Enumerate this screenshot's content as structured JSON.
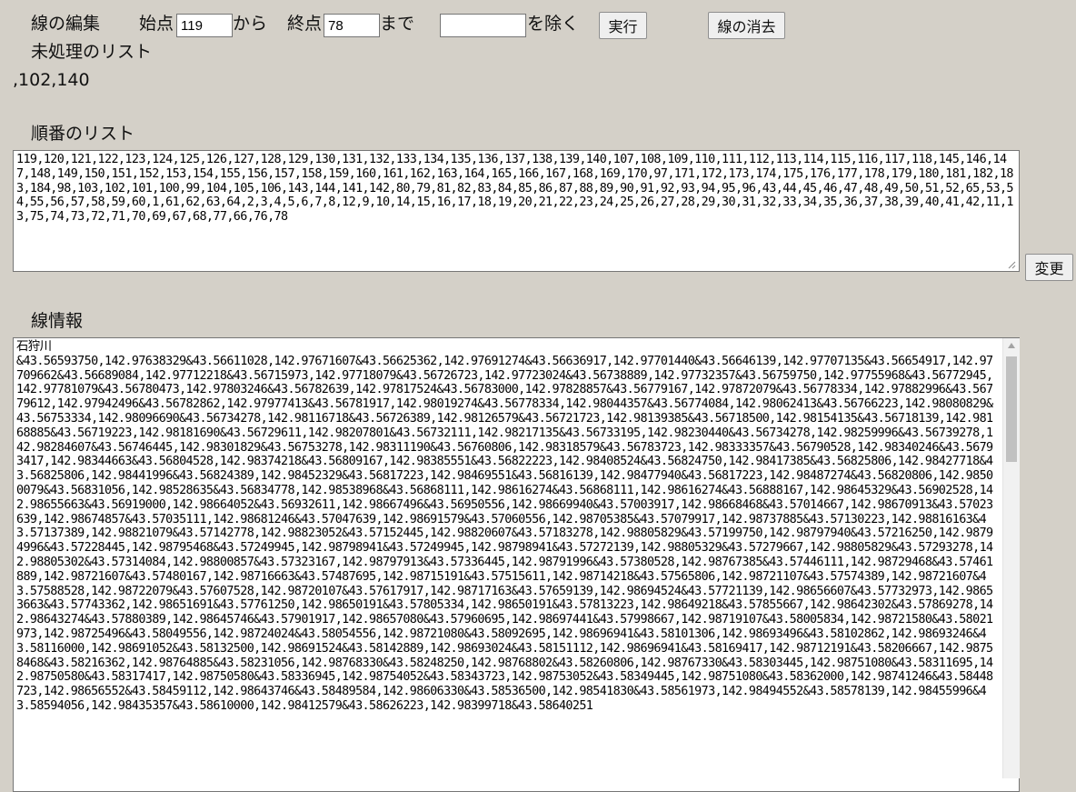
{
  "toolbar": {
    "title": "線の編集",
    "start_label": "始点",
    "start_value": "119",
    "from_label": "から",
    "end_label": "終点",
    "end_value": "78",
    "until_label": "まで",
    "exclude_value": "",
    "exclude_label": "を除く",
    "run_button": "実行",
    "clear_button": "線の消去"
  },
  "unprocessed": {
    "heading": "未処理のリスト",
    "value": ",102,140"
  },
  "order": {
    "heading": "順番のリスト",
    "value": "119,120,121,122,123,124,125,126,127,128,129,130,131,132,133,134,135,136,137,138,139,140,107,108,109,110,111,112,113,114,115,116,117,118,145,146,147,148,149,150,151,152,153,154,155,156,157,158,159,160,161,162,163,164,165,166,167,168,169,170,97,171,172,173,174,175,176,177,178,179,180,181,182,183,184,98,103,102,101,100,99,104,105,106,143,144,141,142,80,79,81,82,83,84,85,86,87,88,89,90,91,92,93,94,95,96,43,44,45,46,47,48,49,50,51,52,65,53,54,55,56,57,58,59,60,1,61,62,63,64,2,3,4,5,6,7,8,12,9,10,14,15,16,17,18,19,20,21,22,23,24,25,26,27,28,29,30,31,32,33,34,35,36,37,38,39,40,41,42,11,13,75,74,73,72,71,70,69,67,68,77,66,76,78",
    "change_button": "変更"
  },
  "line_info": {
    "heading": "線情報",
    "value": "石狩川\n&43.56593750,142.97638329&43.56611028,142.97671607&43.56625362,142.97691274&43.56636917,142.97701440&43.56646139,142.97707135&43.56654917,142.97709662&43.56689084,142.97712218&43.56715973,142.97718079&43.56726723,142.97723024&43.56738889,142.97732357&43.56759750,142.97755968&43.56772945,142.97781079&43.56780473,142.97803246&43.56782639,142.97817524&43.56783000,142.97828857&43.56779167,142.97872079&43.56778334,142.97882996&43.56779612,142.97942496&43.56782862,142.97977413&43.56781917,142.98019274&43.56778334,142.98044357&43.56774084,142.98062413&43.56766223,142.98080829&43.56753334,142.98096690&43.56734278,142.98116718&43.56726389,142.98126579&43.56721723,142.98139385&43.56718500,142.98154135&43.56718139,142.98168885&43.56719223,142.98181690&43.56729611,142.98207801&43.56732111,142.98217135&43.56733195,142.98230440&43.56734278,142.98259996&43.56739278,142.98284607&43.56746445,142.98301829&43.56753278,142.98311190&43.56760806,142.98318579&43.56783723,142.98333357&43.56790528,142.98340246&43.56793417,142.98344663&43.56804528,142.98374218&43.56809167,142.98385551&43.56822223,142.98408524&43.56824750,142.98417385&43.56825806,142.98427718&43.56825806,142.98441996&43.56824389,142.98452329&43.56817223,142.98469551&43.56816139,142.98477940&43.56817223,142.98487274&43.56820806,142.98500079&43.56831056,142.98528635&43.56834778,142.98538968&43.56868111,142.98616274&43.56868111,142.98616274&43.56888167,142.98645329&43.56902528,142.98655663&43.56919000,142.98664052&43.56932611,142.98667496&43.56950556,142.98669940&43.57003917,142.98668468&43.57014667,142.98670913&43.57023639,142.98674857&43.57035111,142.98681246&43.57047639,142.98691579&43.57060556,142.98705385&43.57079917,142.98737885&43.57130223,142.98816163&43.57137389,142.98821079&43.57142778,142.98823052&43.57152445,142.98820607&43.57183278,142.98805829&43.57199750,142.98797940&43.57216250,142.98794996&43.57228445,142.98795468&43.57249945,142.98798941&43.57249945,142.98798941&43.57272139,142.98805329&43.57279667,142.98805829&43.57293278,142.98805302&43.57314084,142.98800857&43.57323167,142.98797913&43.57336445,142.98791996&43.57380528,142.98767385&43.57446111,142.98729468&43.57461889,142.98721607&43.57480167,142.98716663&43.57487695,142.98715191&43.57515611,142.98714218&43.57565806,142.98721107&43.57574389,142.98721607&43.57588528,142.98722079&43.57607528,142.98720107&43.57617917,142.98717163&43.57659139,142.98694524&43.57721139,142.98656607&43.57732973,142.98653663&43.57743362,142.98651691&43.57761250,142.98650191&43.57805334,142.98650191&43.57813223,142.98649218&43.57855667,142.98642302&43.57869278,142.98643274&43.57880389,142.98645746&43.57901917,142.98657080&43.57960695,142.98697441&43.57998667,142.98719107&43.58005834,142.98721580&43.58021973,142.98725496&43.58049556,142.98724024&43.58054556,142.98721080&43.58092695,142.98696941&43.58101306,142.98693496&43.58102862,142.98693246&43.58116000,142.98691052&43.58132500,142.98691524&43.58142889,142.98693024&43.58151112,142.98696941&43.58169417,142.98712191&43.58206667,142.98758468&43.58216362,142.98764885&43.58231056,142.98768330&43.58248250,142.98768802&43.58260806,142.98767330&43.58303445,142.98751080&43.58311695,142.98750580&43.58317417,142.98750580&43.58336945,142.98754052&43.58343723,142.98753052&43.58349445,142.98751080&43.58362000,142.98741246&43.58448723,142.98656552&43.58459112,142.98643746&43.58489584,142.98606330&43.58536500,142.98541830&43.58561973,142.98494552&43.58578139,142.98455996&43.58594056,142.98435357&43.58610000,142.98412579&43.58626223,142.98399718&43.58640251"
  }
}
